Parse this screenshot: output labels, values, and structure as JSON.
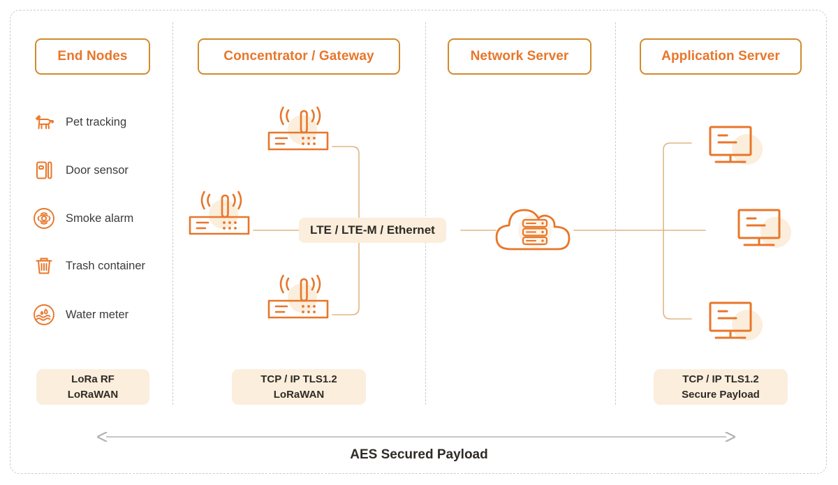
{
  "diagram": {
    "title_caption": "AES Secured Payload",
    "accent_orange": "#e8762a",
    "accent_border": "#d18b2c",
    "pill_bg": "#fbeedc",
    "line_color": "#e0b583",
    "divider_color": "#c9cdd2",
    "arrow_color": "#b3b3b3"
  },
  "columns": [
    {
      "header": "End Nodes",
      "footer": [
        "LoRa RF",
        "LoRaWAN"
      ]
    },
    {
      "header": "Concentrator / Gateway",
      "footer": [
        "TCP / IP TLS1.2",
        "LoRaWAN"
      ]
    },
    {
      "header": "Network Server",
      "footer": []
    },
    {
      "header": "Application Server",
      "footer": [
        "TCP / IP TLS1.2",
        "Secure Payload"
      ]
    }
  ],
  "end_nodes": [
    {
      "label": "Pet tracking",
      "icon": "pet-tracking-icon"
    },
    {
      "label": "Door sensor",
      "icon": "door-sensor-icon"
    },
    {
      "label": "Smoke alarm",
      "icon": "smoke-alarm-icon"
    },
    {
      "label": "Trash container",
      "icon": "trash-container-icon"
    },
    {
      "label": "Water meter",
      "icon": "water-meter-icon"
    }
  ],
  "gateways": [
    {
      "icon": "gateway-router-icon",
      "position": "top"
    },
    {
      "icon": "gateway-router-icon",
      "position": "middle"
    },
    {
      "icon": "gateway-router-icon",
      "position": "bottom"
    }
  ],
  "backhaul": {
    "label": "LTE / LTE-M / Ethernet"
  },
  "network_server": {
    "icon": "cloud-server-icon"
  },
  "app_servers": [
    {
      "icon": "monitor-icon",
      "position": "top"
    },
    {
      "icon": "monitor-icon",
      "position": "middle"
    },
    {
      "icon": "monitor-icon",
      "position": "bottom"
    }
  ]
}
